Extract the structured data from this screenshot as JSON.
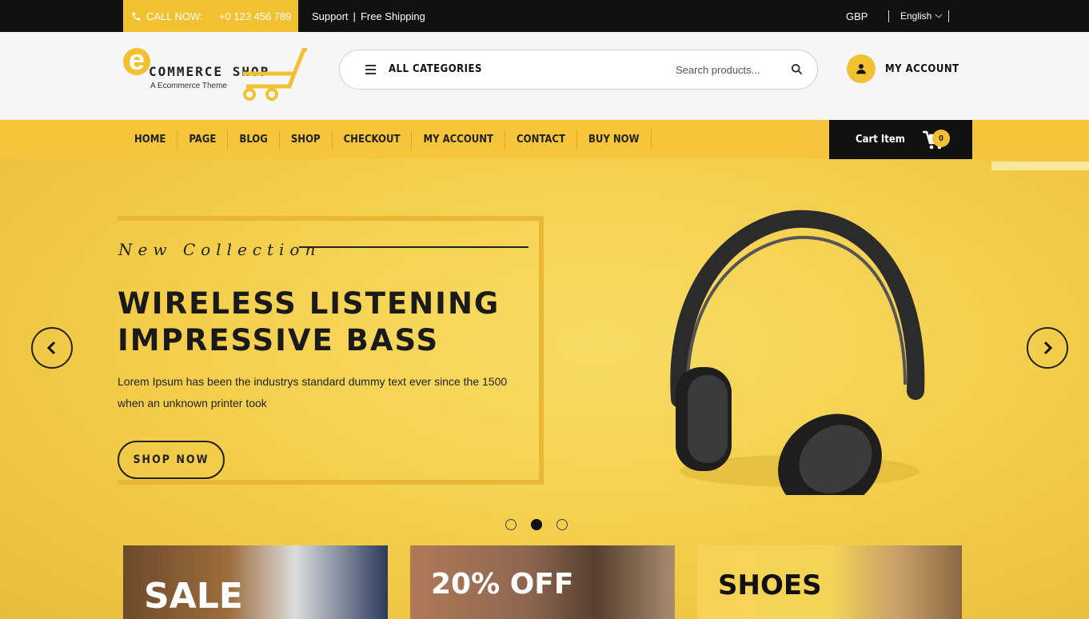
{
  "topbar": {
    "call_label": "CALL NOW:",
    "call_number": "+0 123 456 789",
    "support": "Support",
    "separator": "|",
    "shipping": "Free Shipping",
    "currency": "GBP",
    "language": "English"
  },
  "logo": {
    "letter": "e",
    "name": "COMMERCE SHOP",
    "tagline": "A Ecommerce Theme"
  },
  "search": {
    "categories_label": "ALL CATEGORIES",
    "placeholder": "Search products..."
  },
  "account": {
    "label": "MY ACCOUNT"
  },
  "nav": {
    "items": [
      "HOME",
      "PAGE",
      "BLOG",
      "SHOP",
      "CHECKOUT",
      "MY ACCOUNT",
      "CONTACT",
      "BUY NOW"
    ]
  },
  "cart": {
    "label": "Cart Item",
    "count": "0"
  },
  "hero": {
    "kicker": "New Collection",
    "headline_line1": "WIRELESS LISTENING",
    "headline_line2": "IMPRESSIVE BASS",
    "description": "Lorem Ipsum has been the industrys standard dummy text ever since the 1500 when an unknown printer took",
    "button": "SHOP NOW",
    "active_slide": 2,
    "slide_count": 3
  },
  "promos": [
    {
      "label": "SALE"
    },
    {
      "label": "20% OFF"
    },
    {
      "label": "SHOES"
    }
  ],
  "colors": {
    "accent": "#f2c132",
    "dark": "#111111",
    "nav": "#f5c53b"
  },
  "icons": [
    "phone-icon",
    "menu-icon",
    "search-icon",
    "user-icon",
    "cart-icon",
    "chevron-left-icon",
    "chevron-right-icon",
    "chevron-down-icon"
  ]
}
